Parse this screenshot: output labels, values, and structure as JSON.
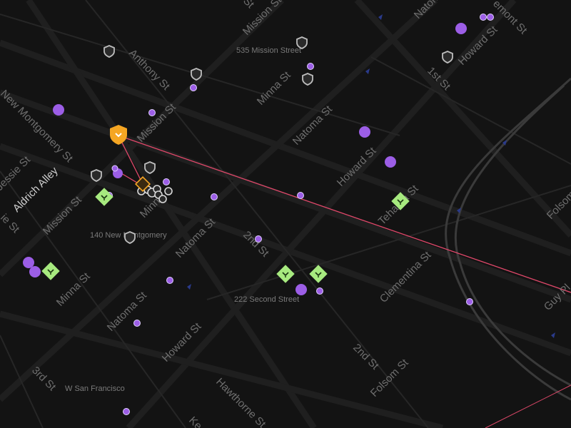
{
  "map": {
    "streets": [
      {
        "id": "mission-st-top",
        "text": "Mission St"
      },
      {
        "id": "mission-st-mid",
        "text": "Mission St"
      },
      {
        "id": "mission-st-left",
        "text": "Mission St"
      },
      {
        "id": "anthony-st",
        "text": "Anthony St"
      },
      {
        "id": "minna-st-top",
        "text": "Minna St"
      },
      {
        "id": "minna-st-left",
        "text": "Minna St"
      },
      {
        "id": "minna-st-center",
        "text": "Minna"
      },
      {
        "id": "natoma-st-top",
        "text": "Natoma St"
      },
      {
        "id": "natoma-st-topright",
        "text": "Natoma"
      },
      {
        "id": "natoma-st-mid",
        "text": "Natoma St"
      },
      {
        "id": "natoma-st-left",
        "text": "Natoma St"
      },
      {
        "id": "howard-st-top",
        "text": "Howard St"
      },
      {
        "id": "howard-st-mid",
        "text": "Howard St"
      },
      {
        "id": "howard-st-bottom",
        "text": "Howard St"
      },
      {
        "id": "new-montgomery-st",
        "text": "New Montgomery St"
      },
      {
        "id": "jessie-st",
        "text": "Jessie St"
      },
      {
        "id": "aldrich-alley",
        "text": "Aldrich Alley"
      },
      {
        "id": "second-st-top",
        "text": "2nd St"
      },
      {
        "id": "second-st-bottom",
        "text": "2nd St"
      },
      {
        "id": "first-st",
        "text": "1st St"
      },
      {
        "id": "fremont-st",
        "text": "emont St"
      },
      {
        "id": "tehama-st",
        "text": "Tehama St"
      },
      {
        "id": "clementina-st",
        "text": "Clementina St"
      },
      {
        "id": "folsom-st",
        "text": "Folsom St"
      },
      {
        "id": "folsom-st-right",
        "text": "Folsom"
      },
      {
        "id": "third-st",
        "text": "3rd St"
      },
      {
        "id": "hawthorne-st",
        "text": "Hawthorne St"
      },
      {
        "id": "guy-pl",
        "text": "Guy Pl"
      },
      {
        "id": "ecker-st",
        "text": "Ke"
      },
      {
        "id": "jessie-left",
        "text": "ie St"
      },
      {
        "id": "mission-top-partial",
        "text": "St"
      }
    ],
    "places": [
      {
        "id": "535-mission",
        "text": "535 Mission Street"
      },
      {
        "id": "140-new-montgomery",
        "text": "140 New Montgomery"
      },
      {
        "id": "222-second",
        "text": "222 Second Street"
      },
      {
        "id": "w-san-francisco",
        "text": "W San Francisco"
      }
    ],
    "colors": {
      "background": "#131313",
      "street": "#6e6e6e",
      "purple": "#9c5ee6",
      "green": "#a7ea7f",
      "orange": "#f5a623",
      "route": "#e0486a",
      "shield": "#bdbdbd"
    },
    "icons": {
      "shield": "shield-icon",
      "marker": "chevron-down-icon"
    }
  }
}
